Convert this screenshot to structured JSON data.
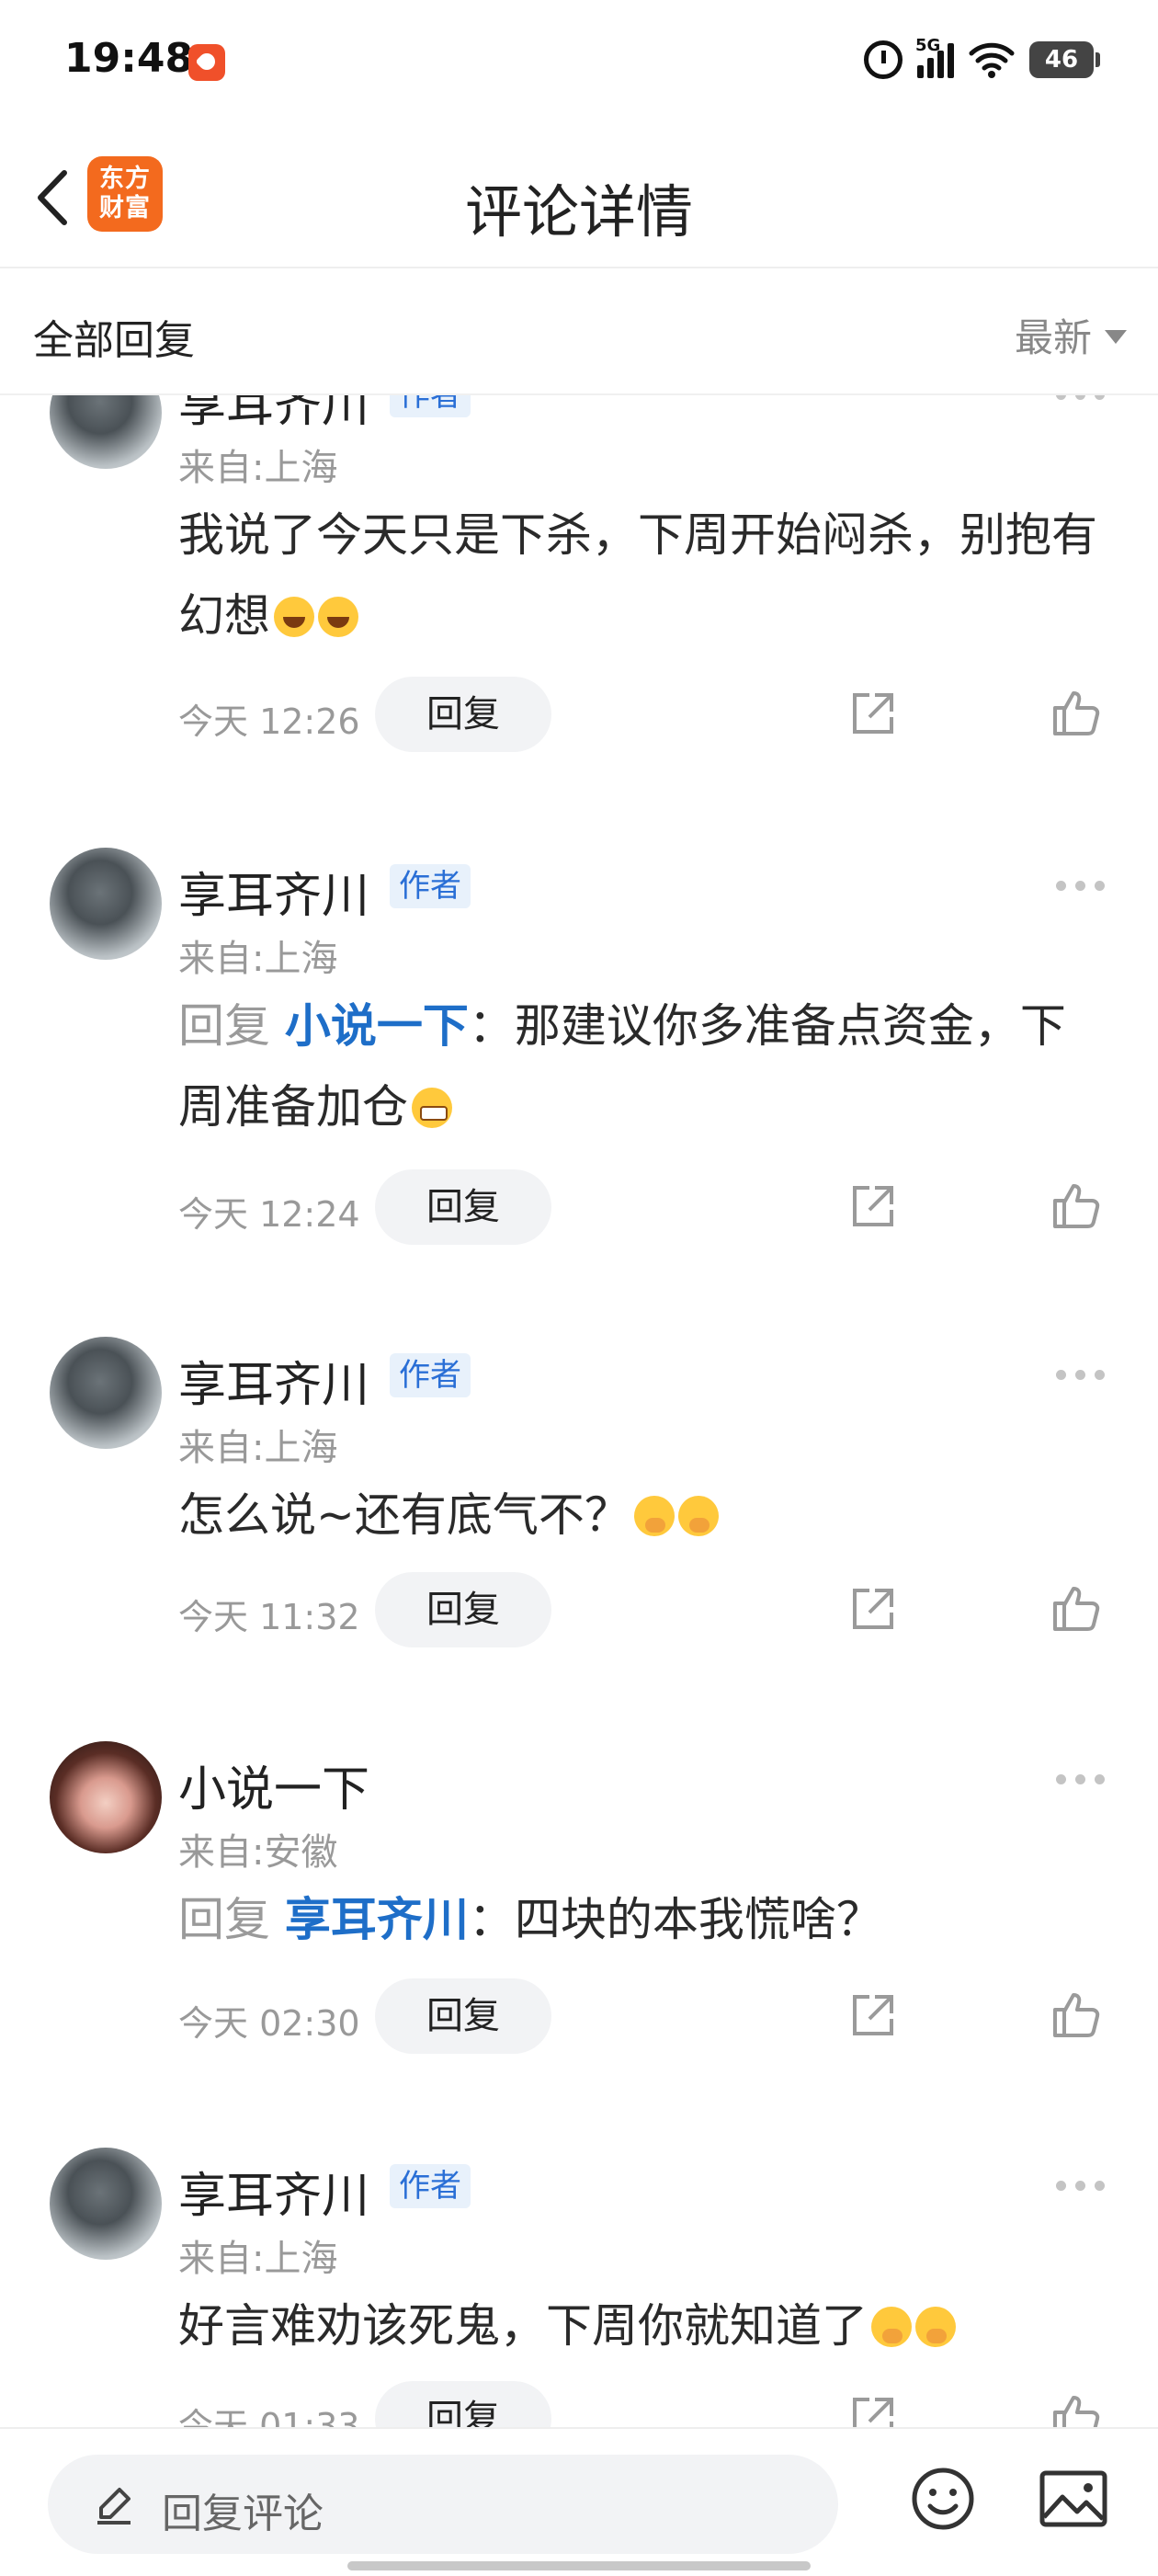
{
  "status_bar": {
    "time": "19:48",
    "network": "5G",
    "battery": "46"
  },
  "header": {
    "brand_logo_line1": "东方",
    "brand_logo_line2": "财富",
    "title": "评论详情"
  },
  "sort_bar": {
    "title": "全部回复",
    "sort_value": "最新"
  },
  "comments": [
    {
      "name": "享耳齐川",
      "badge": "作者",
      "location": "来自:上海",
      "text": "我说了今天只是下杀，下周开始闷杀，别抱有幻想",
      "time": "今天 12:26",
      "reply_label": "回复"
    },
    {
      "name": "享耳齐川",
      "badge": "作者",
      "location": "来自:上海",
      "reply_prefix": "回复",
      "reply_user": "小说一下",
      "text": "：那建议你多准备点资金，下周准备加仓",
      "time": "今天 12:24",
      "reply_label": "回复"
    },
    {
      "name": "享耳齐川",
      "badge": "作者",
      "location": "来自:上海",
      "text": "怎么说~还有底气不？",
      "time": "今天 11:32",
      "reply_label": "回复"
    },
    {
      "name": "小说一下",
      "location": "来自:安徽",
      "reply_prefix": "回复",
      "reply_user": "享耳齐川",
      "text": "：四块的本我慌啥？",
      "time": "今天 02:30",
      "reply_label": "回复"
    },
    {
      "name": "享耳齐川",
      "badge": "作者",
      "location": "来自:上海",
      "text": "好言难劝该死鬼，下周你就知道了",
      "time": "今天 01:33",
      "reply_label": "回复"
    }
  ],
  "bottom_bar": {
    "placeholder": "回复评论"
  },
  "icons": {
    "back": "back-arrow-icon",
    "share": "share-icon",
    "like": "thumbs-up-icon",
    "more": "more-dots-icon",
    "pencil": "pencil-icon",
    "emoji": "emoji-icon",
    "image": "image-icon"
  },
  "colors": {
    "brand": "#f36a1e",
    "link": "#1e6ec8",
    "badge_bg": "#e8f1fb",
    "badge_text": "#2a6fd6"
  }
}
